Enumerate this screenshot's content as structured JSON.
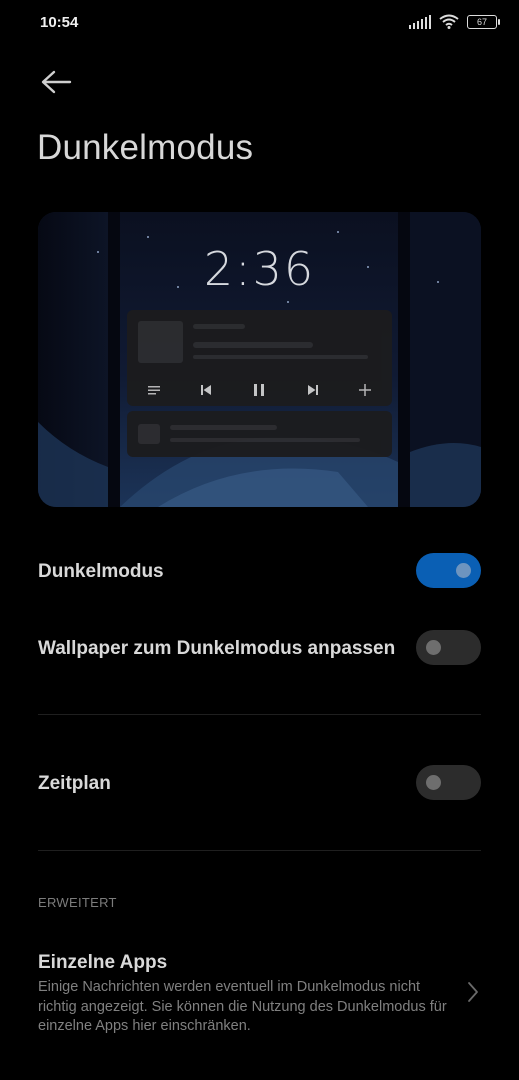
{
  "status": {
    "time": "10:54",
    "battery": "67"
  },
  "header": {
    "title": "Dunkelmodus"
  },
  "preview": {
    "clock": "2:36"
  },
  "settings": {
    "dark_mode": {
      "label": "Dunkelmodus",
      "state": "on"
    },
    "wallpaper": {
      "label": "Wallpaper zum Dunkelmodus anpassen",
      "state": "off"
    },
    "schedule": {
      "label": "Zeitplan",
      "state": "off"
    }
  },
  "advanced": {
    "header": "ERWEITERT",
    "apps_title": "Einzelne Apps",
    "apps_description": "Einige Nachrichten werden eventuell im Dunkelmodus nicht richtig angezeigt. Sie können die Nutzung des Dunkelmodus für einzelne Apps hier einschränken."
  },
  "colors": {
    "accent": "#0a5fb4",
    "background": "#000000"
  },
  "icons": [
    "back-arrow-icon",
    "signal-icon",
    "wifi-icon",
    "battery-icon",
    "chevron-right-icon"
  ]
}
